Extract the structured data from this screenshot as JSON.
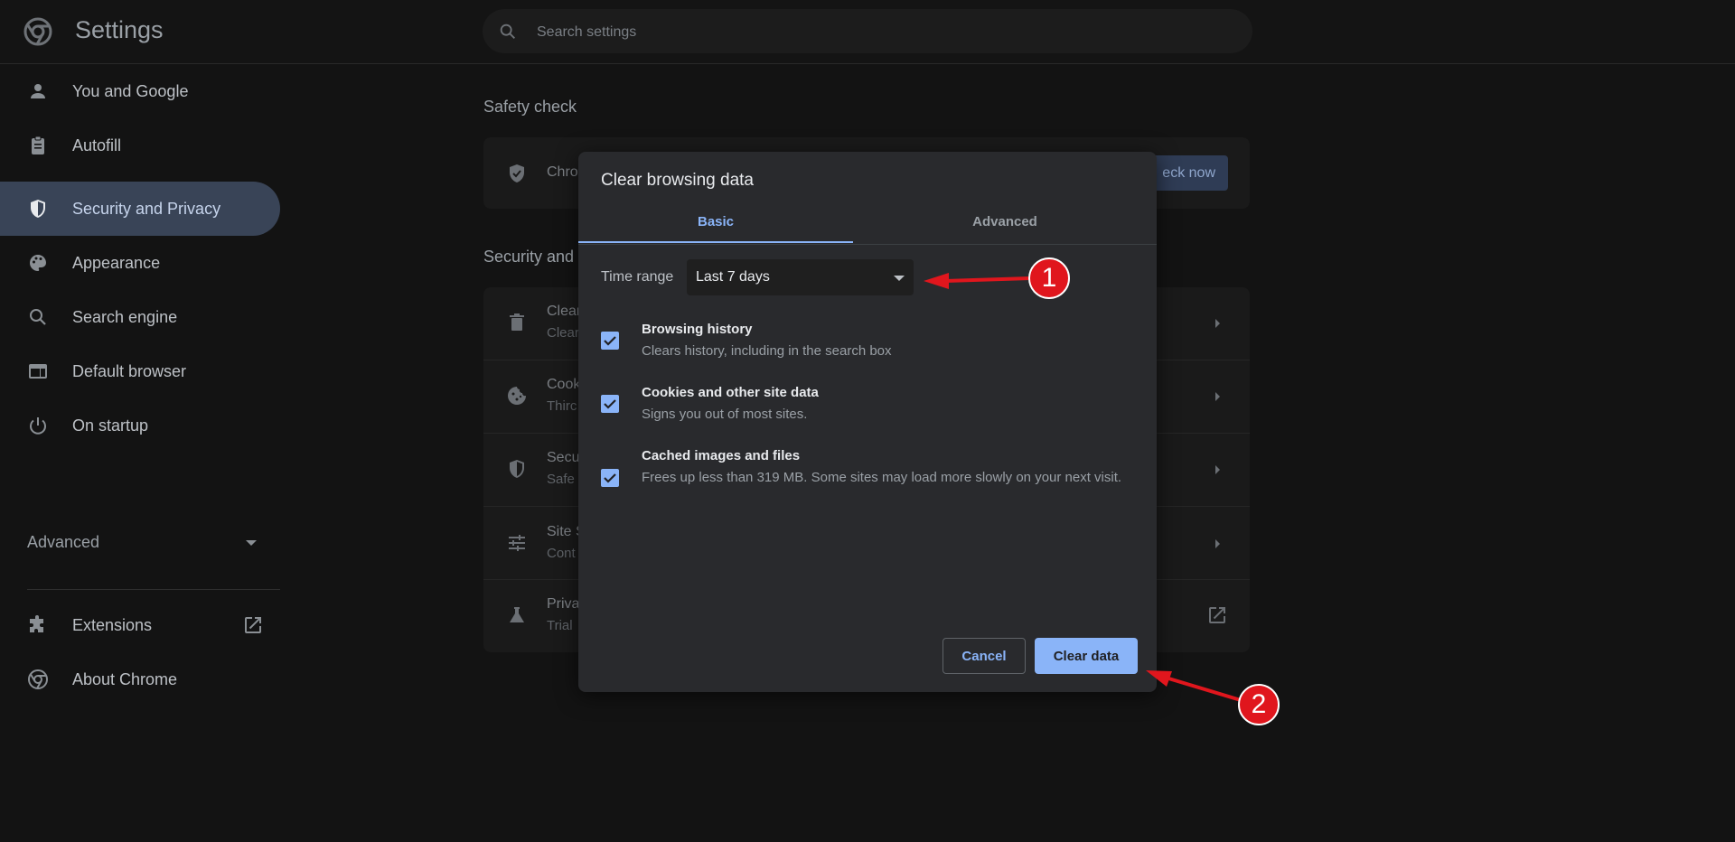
{
  "header": {
    "app_title": "Settings",
    "search_placeholder": "Search settings"
  },
  "sidebar": {
    "items": [
      {
        "label": "You and Google",
        "icon": "person-icon"
      },
      {
        "label": "Autofill",
        "icon": "clipboard-icon"
      },
      {
        "label": "Security and Privacy",
        "icon": "shield-icon",
        "active": true
      },
      {
        "label": "Appearance",
        "icon": "palette-icon"
      },
      {
        "label": "Search engine",
        "icon": "search-icon"
      },
      {
        "label": "Default browser",
        "icon": "browser-icon"
      },
      {
        "label": "On startup",
        "icon": "power-icon"
      }
    ],
    "advanced_label": "Advanced",
    "extensions_label": "Extensions",
    "about_label": "About Chrome"
  },
  "main": {
    "safety_check_title": "Safety check",
    "safety_row_text": "Chro",
    "check_now_label": "eck now",
    "privacy_section_title": "Security and",
    "rows": [
      {
        "title": "Clear",
        "sub": "Clear"
      },
      {
        "title": "Cook",
        "sub": "Thirc"
      },
      {
        "title": "Secu",
        "sub": "Safe"
      },
      {
        "title": "Site S",
        "sub": "Cont"
      },
      {
        "title": "Priva",
        "sub": "Trial"
      }
    ]
  },
  "dialog": {
    "title": "Clear browsing data",
    "tabs": {
      "basic": "Basic",
      "advanced": "Advanced"
    },
    "time_range_label": "Time range",
    "time_range_value": "Last 7 days",
    "options": [
      {
        "title": "Browsing history",
        "desc": "Clears history, including in the search box",
        "checked": true
      },
      {
        "title": "Cookies and other site data",
        "desc": "Signs you out of most sites.",
        "checked": true
      },
      {
        "title": "Cached images and files",
        "desc": "Frees up less than 319 MB. Some sites may load more slowly on your next visit.",
        "checked": true
      }
    ],
    "cancel_label": "Cancel",
    "clear_label": "Clear data"
  },
  "annotations": {
    "badge_1": "1",
    "badge_2": "2"
  },
  "colors": {
    "accent": "#8ab4f8",
    "annotation_red": "#e0161d",
    "active_nav_bg": "#394457"
  }
}
